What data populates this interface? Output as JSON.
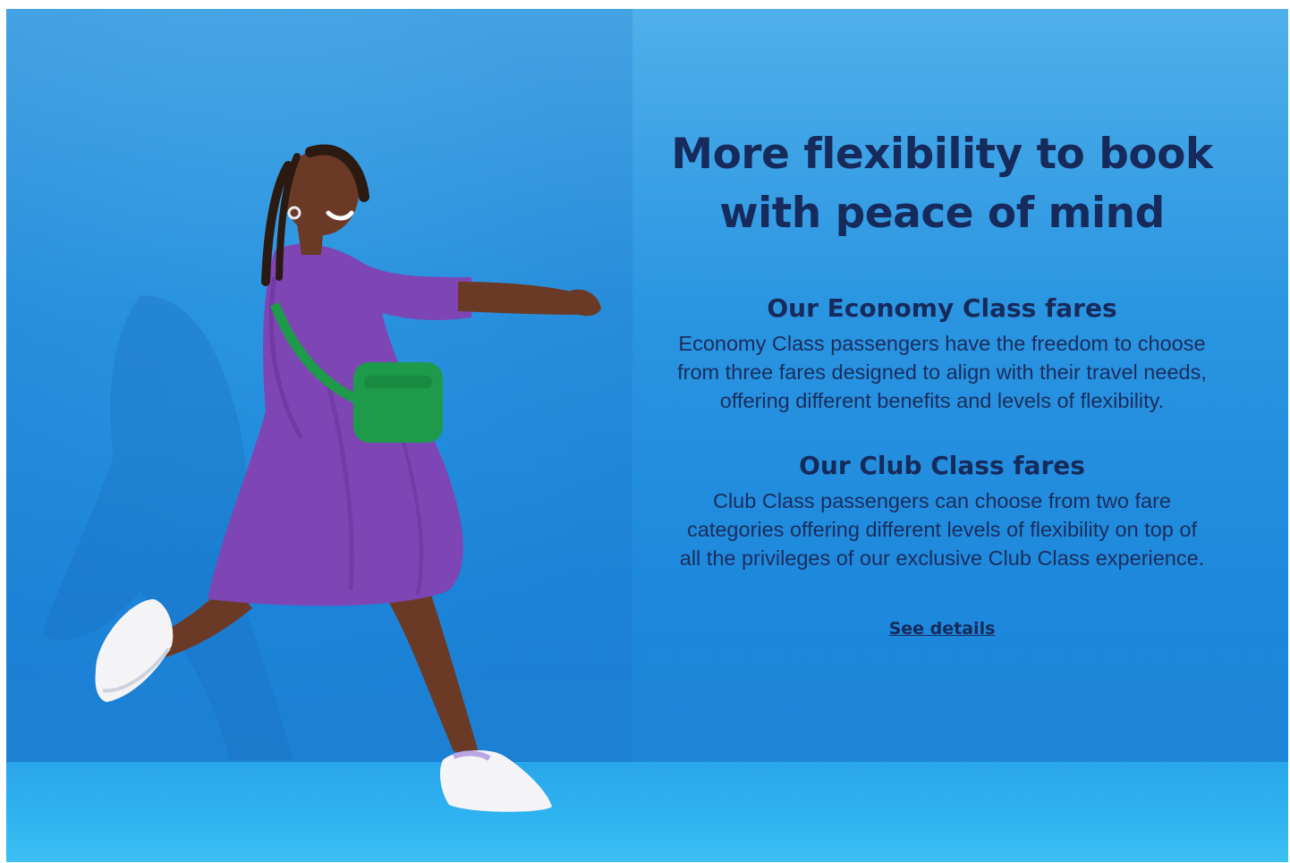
{
  "hero": {
    "headline": "More flexibility to book with peace of mind",
    "see_details_label": "See details"
  },
  "sections": [
    {
      "title": "Our Economy Class fares",
      "body": "Economy Class passengers have the freedom to choose from three fares designed to align with their travel needs, offering different benefits and levels of flexibility."
    },
    {
      "title": "Our Club Class fares",
      "body": "Club Class passengers can choose from two fare categories offering different levels of flexibility on top of all the privileges of our exclusive Club Class experience."
    }
  ],
  "colors": {
    "background": "#2a95e1",
    "text": "#172a5c",
    "dress": "#7e45b4",
    "bag": "#1e9a4b"
  }
}
